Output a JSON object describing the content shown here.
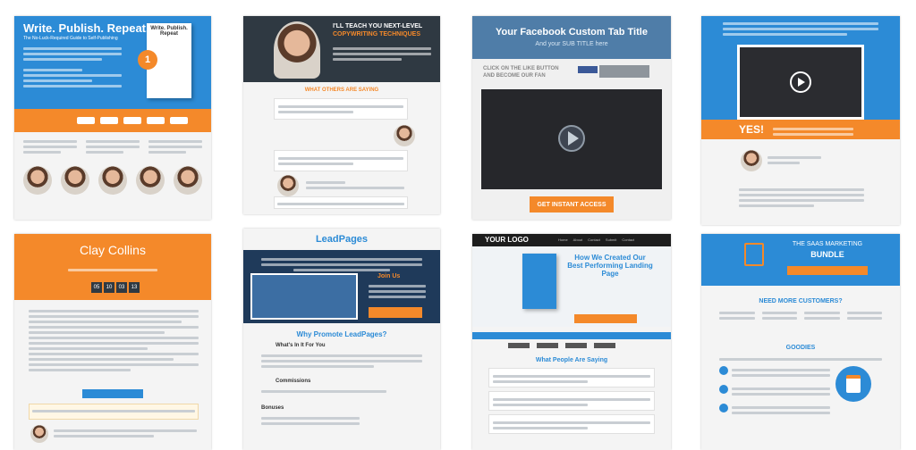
{
  "colors": {
    "blue": "#2c8bd6",
    "orange": "#f4892a",
    "dark": "#2f3942",
    "navy": "#1f3a5a",
    "video": "#26272b"
  },
  "t1": {
    "title": "Write. Publish. Repeat.",
    "subtitle": "The No-Luck-Required Guide to Self-Publishing",
    "book_title": "Write. Publish. Repeat",
    "badge": "1"
  },
  "t2": {
    "headline": "I'LL TEACH YOU NEXT-LEVEL",
    "headline2": "COPYWRITING TECHNIQUES",
    "section": "WHAT OTHERS ARE SAYING"
  },
  "t3": {
    "title": "Your Facebook Custom Tab Title",
    "subtitle": "And your SUB TITLE here",
    "like_text": "CLICK ON THE LIKE BUTTON",
    "like_text2": "AND BECOME OUR FAN",
    "cta": "GET INSTANT ACCESS"
  },
  "t4": {
    "yes": "YES!",
    "play_icon": "play-icon"
  },
  "t5": {
    "name": "Clay Collins",
    "timer": [
      "05",
      "10",
      "03",
      "13"
    ]
  },
  "t6": {
    "logo": "LeadPages",
    "join": "Join Us",
    "section": "Why Promote LeadPages?",
    "item1": "What's In It For You",
    "item2": "Commissions",
    "item3": "Bonuses"
  },
  "t7": {
    "logo": "YOUR LOGO",
    "nav": [
      "Home",
      "About",
      "Contact",
      "Submit",
      "Contact"
    ],
    "headline": "How We Created Our Best Performing Landing Page",
    "section": "What People Are Saying"
  },
  "t8": {
    "title": "THE SAAS MARKETING",
    "title2": "BUNDLE",
    "customers": "NEED MORE CUSTOMERS?",
    "goodies": "GOODIES"
  }
}
